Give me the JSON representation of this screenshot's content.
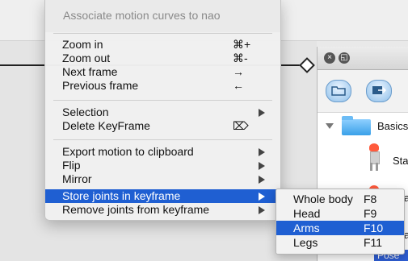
{
  "context_menu": {
    "header": "Associate motion curves to nao",
    "items": [
      {
        "label": "Zoom in",
        "shortcut": "⌘+"
      },
      {
        "label": "Zoom out",
        "shortcut": "⌘-"
      },
      {
        "label": "Next frame",
        "shortcut": "→"
      },
      {
        "label": "Previous frame",
        "shortcut": "←"
      },
      {
        "label": "Selection"
      },
      {
        "label": "Delete KeyFrame",
        "shortcut": "⌦"
      },
      {
        "label": "Export motion to clipboard"
      },
      {
        "label": "Flip"
      },
      {
        "label": "Mirror"
      },
      {
        "label": "Store joints in keyframe"
      },
      {
        "label": "Remove joints from keyframe"
      }
    ]
  },
  "submenu": {
    "items": [
      {
        "label": "Whole body",
        "shortcut": "F8"
      },
      {
        "label": "Head",
        "shortcut": "F9"
      },
      {
        "label": "Arms",
        "shortcut": "F10"
      },
      {
        "label": "Legs",
        "shortcut": "F11"
      }
    ]
  },
  "side_panel": {
    "tree_label": "Basics",
    "row_label_1": "Sta",
    "row_label_2": "a",
    "row_label_3": "a",
    "bottom_label": "Pose"
  },
  "colors": {
    "highlight": "#1f5fd2",
    "menu_bg": "#f0f0f0"
  }
}
